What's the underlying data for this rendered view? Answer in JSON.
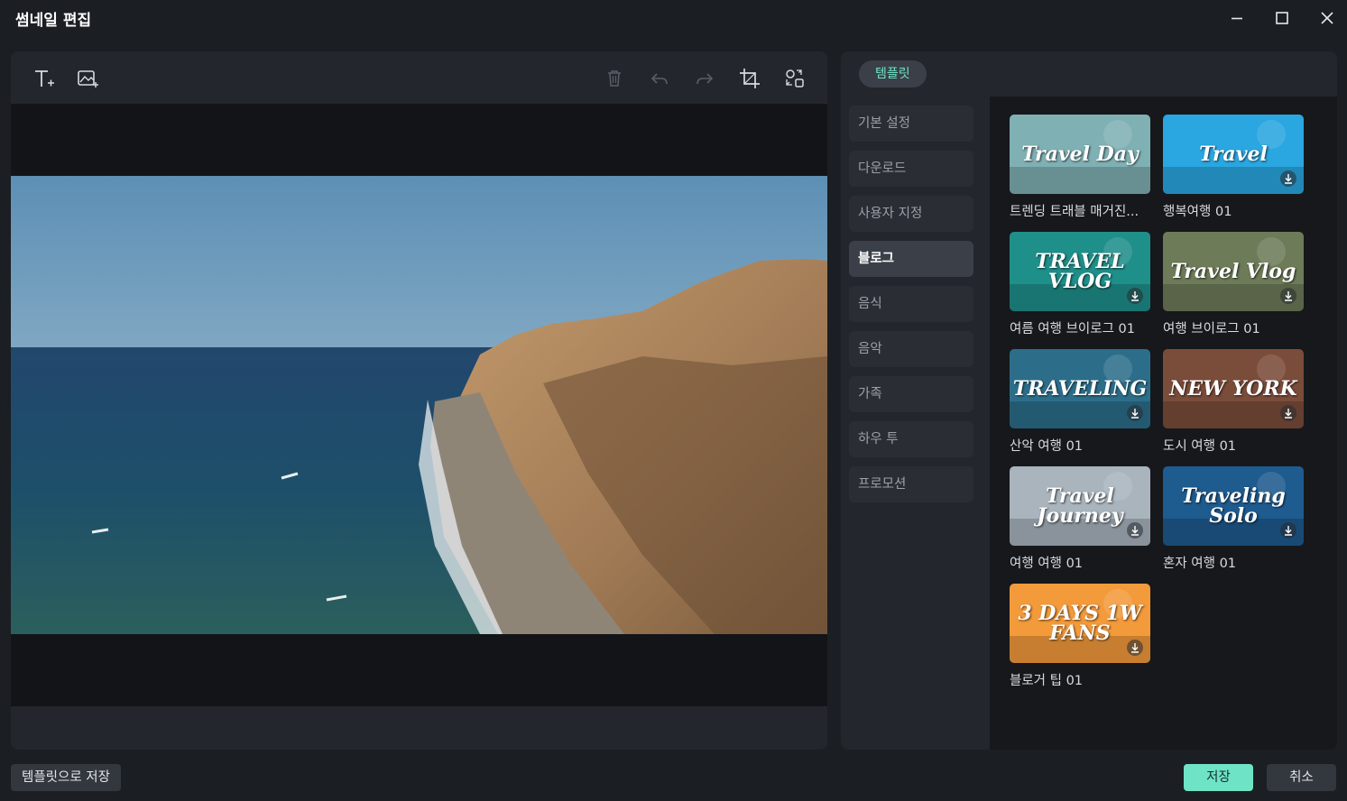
{
  "window": {
    "title": "썸네일 편집"
  },
  "templates": {
    "tab_label": "템플릿",
    "categories": [
      {
        "label": "기본 설정",
        "active": false
      },
      {
        "label": "다운로드",
        "active": false
      },
      {
        "label": "사용자 지정",
        "active": false
      },
      {
        "label": "블로그",
        "active": true
      },
      {
        "label": "음식",
        "active": false
      },
      {
        "label": "음악",
        "active": false
      },
      {
        "label": "가족",
        "active": false
      },
      {
        "label": "하우 투",
        "active": false
      },
      {
        "label": "프로모션",
        "active": false
      }
    ],
    "items": [
      {
        "label": "트렌딩 트래블 매거진...",
        "thumb_text": "Travel Day",
        "bg": "#7fb0b4"
      },
      {
        "label": "행복여행 01",
        "thumb_text": "Travel",
        "bg": "#2aa6e0",
        "download_icon": "download-icon"
      },
      {
        "label": "여름 여행 브이로그 01",
        "thumb_text": "TRAVEL VLOG",
        "bg": "#1f8f8a",
        "download_icon": "download-icon"
      },
      {
        "label": "여행 브이로그 01",
        "thumb_text": "Travel Vlog",
        "bg": "#6d7b58",
        "download_icon": "download-icon"
      },
      {
        "label": "산악 여행 01",
        "thumb_text": "TRAVELING",
        "bg": "#2c6e8a",
        "download_icon": "download-icon"
      },
      {
        "label": "도시 여행 01",
        "thumb_text": "NEW YORK",
        "bg": "#7a4c3a",
        "download_icon": "download-icon"
      },
      {
        "label": "여행 여행 01",
        "thumb_text": "Travel Journey",
        "bg": "#a9b4bd",
        "download_icon": "download-icon"
      },
      {
        "label": "혼자 여행 01",
        "thumb_text": "Traveling Solo",
        "bg": "#1e5b8f",
        "download_icon": "download-icon"
      },
      {
        "label": "블로거 팁 01",
        "thumb_text": "3 DAYS 1W FANS",
        "bg": "#f39a3b",
        "download_icon": "download-icon"
      }
    ]
  },
  "footer": {
    "save_as_template": "템플릿으로 저장",
    "save": "저장",
    "cancel": "취소"
  },
  "colors": {
    "accent": "#6fe3c6",
    "panel": "#23262c",
    "background": "#1b1e23"
  }
}
